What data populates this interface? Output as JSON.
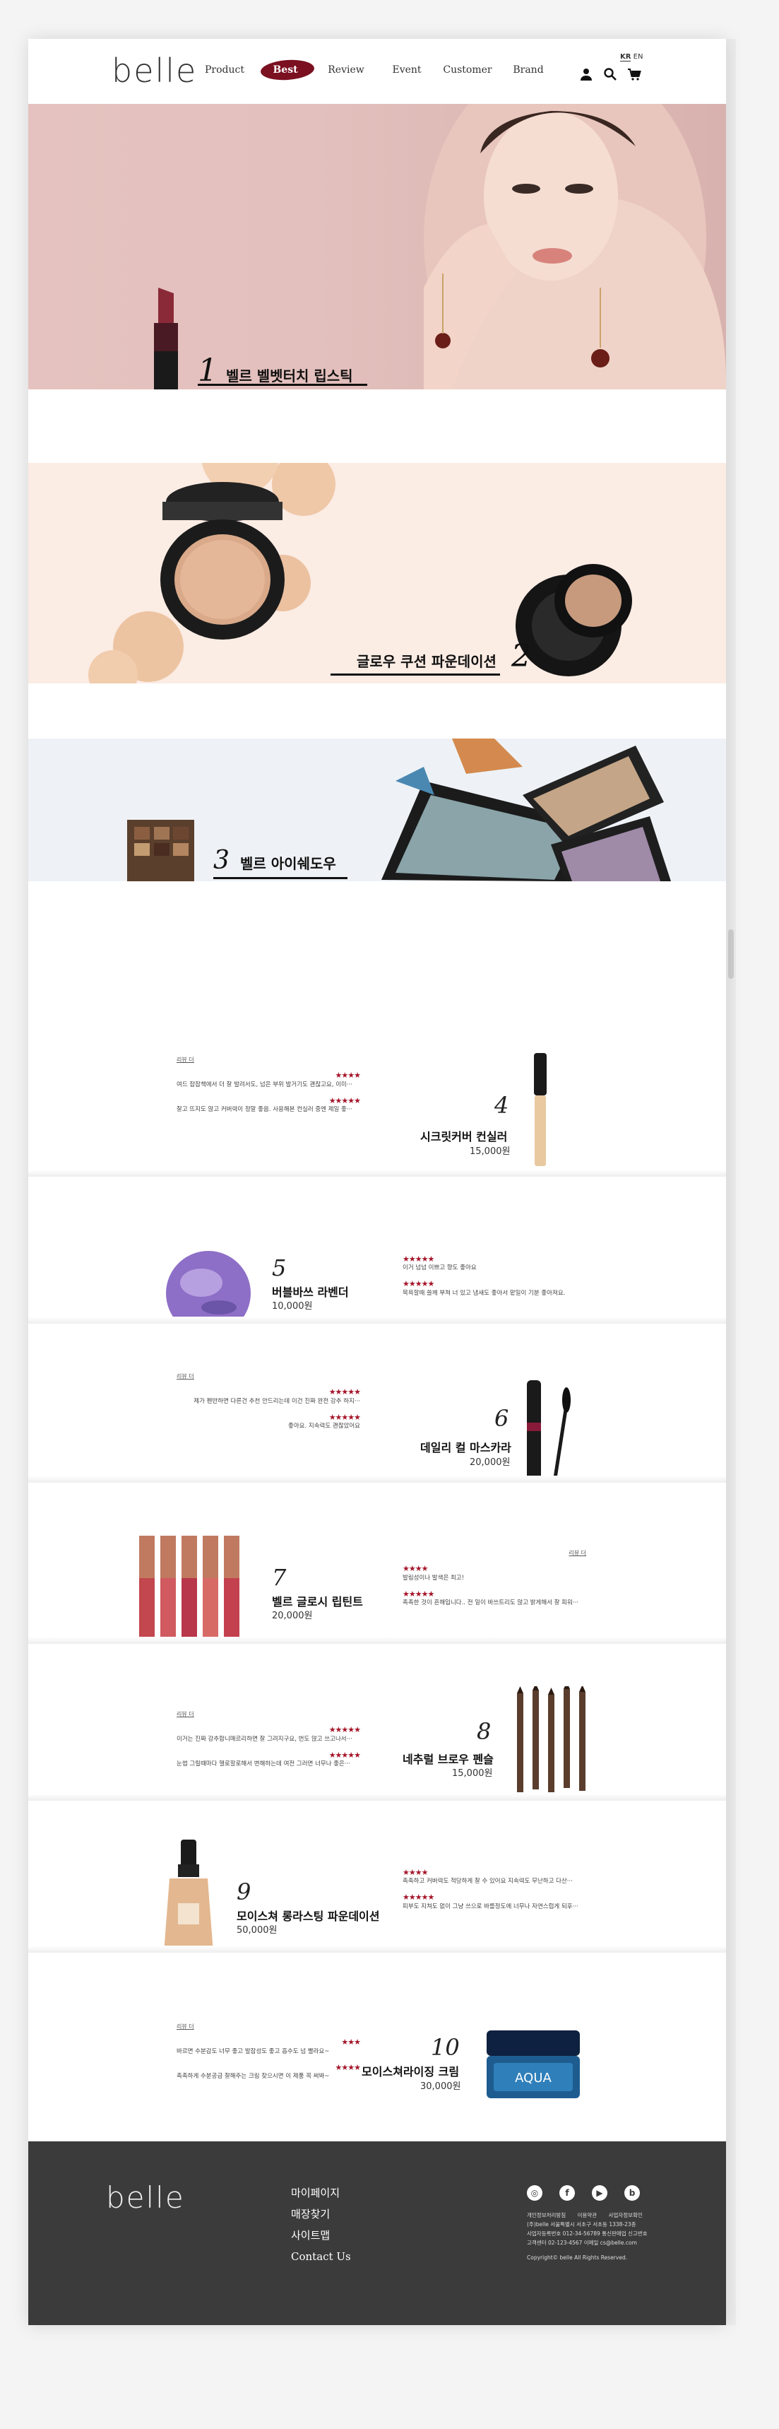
{
  "header": {
    "logo": "belle",
    "lang": {
      "active": "KR",
      "other": "EN"
    },
    "nav": [
      "Product",
      "Best",
      "Review",
      "Event",
      "Customer",
      "Brand"
    ],
    "active_nav": "Best",
    "icons": [
      "user-icon",
      "search-icon",
      "cart-icon"
    ]
  },
  "banners": [
    {
      "num": "1",
      "title": "벨르 벨벳터치 립스틱"
    },
    {
      "num": "2",
      "title": "글로우 쿠션 파운데이션"
    },
    {
      "num": "3",
      "title": "벨르 아이쉐도우"
    }
  ],
  "products": [
    {
      "num": "4",
      "name": "시크릿커버 컨실러",
      "price": "15,000원",
      "reviews": [
        {
          "stars": "★★★★",
          "text": "여드 잡잡책에서 더 잘 발려서도, 넘은 부위 발거기도 괜찮고요, 이미···"
        },
        {
          "stars": "★★★★★",
          "text": "잘고 뜨지도 않고 커버력이 정말 좋음. 사용해본 컨실러 중엔 제일 좋···"
        }
      ]
    },
    {
      "num": "5",
      "name": "버블바쓰 라벤더",
      "price": "10,000원",
      "reviews": [
        {
          "stars": "★★★★★",
          "text": "이거 넘넘 이쁘고 향도 좋아요"
        },
        {
          "stars": "★★★★★",
          "text": "목욕할때 쓸께 부쳐 너 있고 냄새도 좋아서 맡일이 기분 좋아져요."
        }
      ]
    },
    {
      "num": "6",
      "name": "데일리 컬 마스카라",
      "price": "20,000원",
      "reviews": [
        {
          "stars": "★★★★★",
          "text": "제가 펜반하면 다른건 추천 안드리는데 이건 진짜 완전 강추 하지···"
        },
        {
          "stars": "★★★★★",
          "text": "좋아요. 지속력도 괜찮았어요"
        }
      ]
    },
    {
      "num": "7",
      "name": "벨르 글로시 립틴트",
      "price": "20,000원",
      "reviews": [
        {
          "stars": "★★★★",
          "text": "발림성이나 발색은 최고!"
        },
        {
          "stars": "★★★★★",
          "text": "촉촉한 것이 흔해입니다.. 전 일이 바쓰트리도 않고 밝게해서 잘 피워···"
        }
      ]
    },
    {
      "num": "8",
      "name": "네추럴 브로우 펜슬",
      "price": "15,000원",
      "reviews": [
        {
          "stars": "★★★★★",
          "text": "이거는 진짜 강추합니매르리하면 잘 그려지구요, 번도 않고 쓰고나서···"
        },
        {
          "stars": "★★★★★",
          "text": "눈썹 그릴때마다 헬로할로해서 변해하는데 여전 그러면 너무나 좋은···"
        }
      ]
    },
    {
      "num": "9",
      "name": "모이스쳐 롱라스팅 파운데이션",
      "price": "50,000원",
      "reviews": [
        {
          "stars": "★★★★",
          "text": "촉촉하고 커버력도 적당하게 잘 수 있어요 지속력도 무난하고 다산···"
        },
        {
          "stars": "★★★★★",
          "text": "피부도 지쳐도 없이 그냥 쓰으로 바를정도에 너무나 자연스럽게 되후···"
        }
      ]
    },
    {
      "num": "10",
      "name": "모이스쳐라이징 크림",
      "price": "30,000원",
      "reviews": [
        {
          "stars": "★★★",
          "text": "바르면 수분감도 너무 좋고 발잡성도 좋고 흡수도 넘 빨라요~"
        },
        {
          "stars": "★★★★",
          "text": "촉촉하게 수분공급 잘해주는 크림 찾으시면 이 제품 꼭 써봐~"
        }
      ]
    }
  ],
  "review_tag": "리뷰 더",
  "footer": {
    "logo": "belle",
    "links": [
      "마이페이지",
      "매장찾기",
      "사이트맵",
      "Contact Us"
    ],
    "social": [
      "instagram-icon",
      "facebook-icon",
      "youtube-icon",
      "blog-icon"
    ],
    "info_links": [
      "개인정보처리방침",
      "이용약관",
      "사업자정보확인"
    ],
    "info_lines": [
      "(주)belle   서울특별시 서초구 서초동 1338-23층",
      "사업자등록번호 012-34-56789   통신판매업 신고번호",
      "고객센터 02-123-4567   이메일 cs@belle.com"
    ],
    "copyright": "Copyright© belle All Rights Reserved."
  }
}
